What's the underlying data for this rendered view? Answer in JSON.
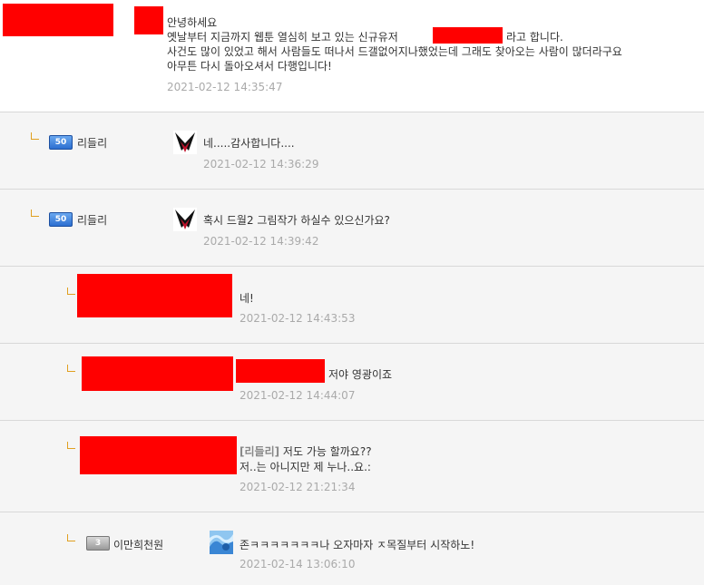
{
  "post": {
    "lines": [
      "안녕하세요",
      "옛날부터 지금까지 웹툰 열심히 보고 있는 신규유저",
      "사건도 많이 있었고 해서 사람들도 떠나서 드갤없어지나했었는데 그래도 찾아오는 사람이 많더라구요",
      "아무튼 다시 돌아오셔서 다행입니다!"
    ],
    "line2_suffix": "라고 합니다.",
    "timestamp": "2021-02-12 14:35:47"
  },
  "comments": [
    {
      "level": "50",
      "nick": "리들리",
      "text": "네.....감사합니다....",
      "timestamp": "2021-02-12 14:36:29"
    },
    {
      "level": "50",
      "nick": "리들리",
      "text": "혹시 드월2 그림작가 하실수 있으신가요?",
      "timestamp": "2021-02-12 14:39:42"
    },
    {
      "text": "네!",
      "timestamp": "2021-02-12 14:43:53"
    },
    {
      "text": "저야 영광이죠",
      "timestamp": "2021-02-12 14:44:07"
    },
    {
      "mention": "[리들리]",
      "text": "저도 가능 할까요??",
      "text2": "저..는 아니지만 제 누나..요.:",
      "timestamp": "2021-02-12 21:21:34"
    },
    {
      "level": "3",
      "nick": "이만희천원",
      "text": "존ㅋㅋㅋㅋㅋㅋㅋ나 오자마자 ㅈ목질부터 시작하노!",
      "timestamp": "2021-02-14 13:06:10"
    }
  ],
  "colors": {
    "redaction": "#ff0000",
    "band": "#f5f5f5",
    "arrow": "#e0a020",
    "timestamp": "#aaaaaa"
  },
  "icons": [
    "reply-arrow-icon",
    "level-badge-icon",
    "avatar-icon"
  ]
}
